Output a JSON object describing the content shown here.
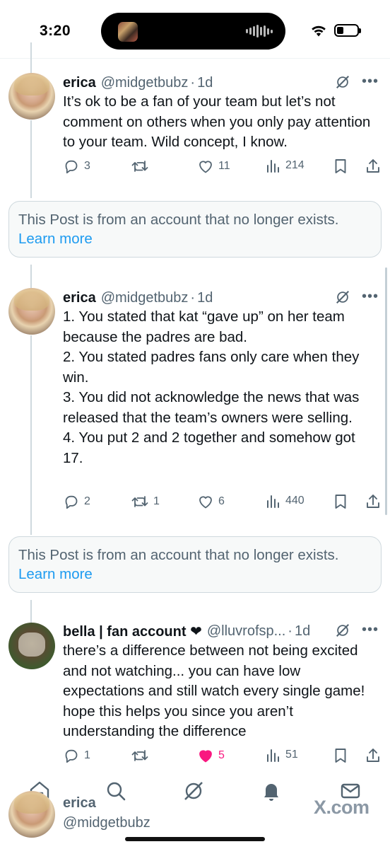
{
  "status_bar": {
    "time": "3:20",
    "icons": [
      "island-thumbnail",
      "audio-wave-icon",
      "wifi-icon",
      "battery-icon"
    ],
    "battery_level": 0.35
  },
  "tweets": [
    {
      "name": "erica",
      "handle": "@midgetbubz",
      "time": "1d",
      "paragraphs": [
        "It’s ok to be a fan of your team but let’s not comment on others when you only pay attention to your team. Wild concept, I know."
      ],
      "replies": "3",
      "reposts": "",
      "likes": "11",
      "views": "214",
      "liked": false
    },
    {
      "name": "erica",
      "handle": "@midgetbubz",
      "time": "1d",
      "paragraphs": [
        "1. You stated that kat “gave up” on her team because the padres are bad.",
        "2. You stated padres fans only care when they win.",
        "3. You did not acknowledge the news that was released that the team’s owners were selling.",
        "4. You put 2 and 2 together and somehow got 17."
      ],
      "replies": "2",
      "reposts": "1",
      "likes": "6",
      "views": "440",
      "liked": false
    },
    {
      "name": "bella | fan account ❤",
      "handle": "@lluvrofsp...",
      "time": "1d",
      "paragraphs": [
        "there’s a difference between not being excited and not watching... you can have low expectations and still watch every single game! hope this helps you since you aren’t understanding the difference"
      ],
      "replies": "1",
      "reposts": "",
      "likes": "5",
      "views": "51",
      "liked": true
    }
  ],
  "notices": [
    {
      "text": "This Post is from an account that no longer exists.",
      "link": "Learn more"
    },
    {
      "text": "This Post is from an account that no longer exists.",
      "link": "Learn more"
    }
  ],
  "bottom_nav": {
    "items": [
      "home-icon",
      "search-icon",
      "grok-icon",
      "notifications-icon",
      "messages-icon"
    ],
    "account_name": "erica",
    "account_handle": "@midgetbubz",
    "watermark": "X.com"
  },
  "colors": {
    "text": "#0f1419",
    "secondary": "#536471",
    "link": "#1d9bf0",
    "like": "#f91880",
    "border": "#cfd9de"
  }
}
